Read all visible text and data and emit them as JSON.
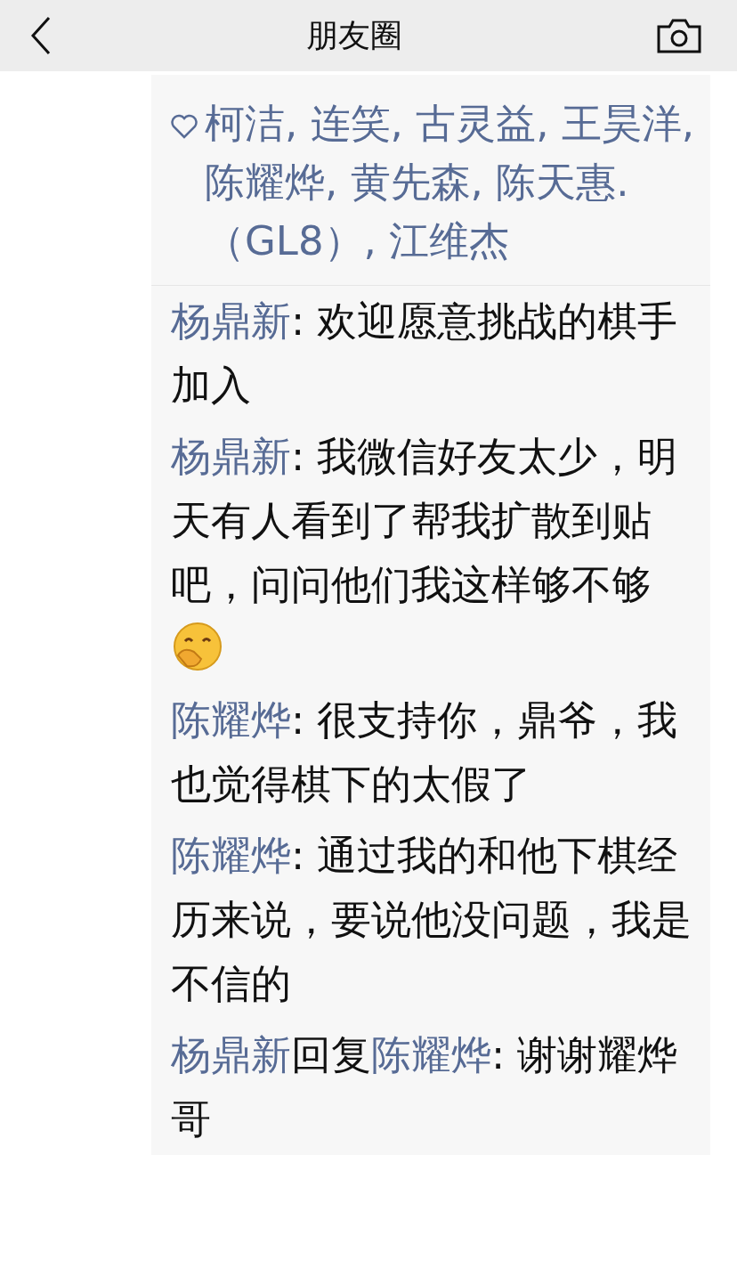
{
  "header": {
    "title": "朋友圈"
  },
  "likes": {
    "names": "柯洁, 连笑, 古灵益, 王昊洋, 陈耀烨, 黄先森, 陈天惠.（GL8）, 江维杰"
  },
  "comments": [
    {
      "author": "杨鼎新",
      "text": ": 欢迎愿意挑战的棋手加入",
      "emoji": false
    },
    {
      "author": "杨鼎新",
      "text": ": 我微信好友太少，明天有人看到了帮我扩散到贴吧，问问他们我这样够不够",
      "emoji": true
    },
    {
      "author": "陈耀烨",
      "text": ": 很支持你，鼎爷，我也觉得棋下的太假了",
      "emoji": false
    },
    {
      "author": "陈耀烨",
      "text": ": 通过我的和他下棋经历来说，要说他没问题，我是不信的",
      "emoji": false
    },
    {
      "author": "杨鼎新",
      "reply_word": "回复",
      "reply_to": "陈耀烨",
      "text": ": 谢谢耀烨哥",
      "emoji": false
    }
  ]
}
